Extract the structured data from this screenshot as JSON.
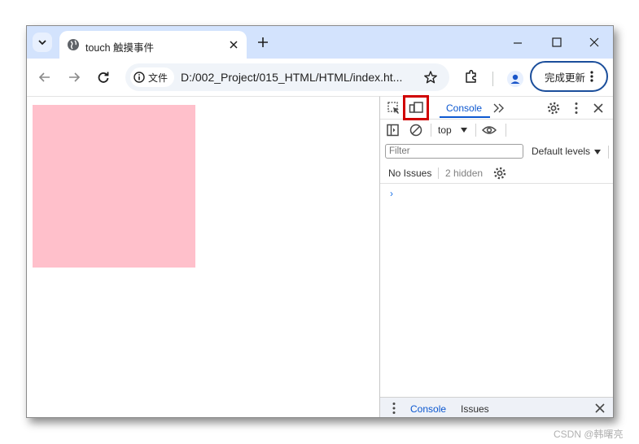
{
  "browser": {
    "tab_title": "touch 触摸事件",
    "url_chip_label": "文件",
    "url": "D:/002_Project/015_HTML/HTML/index.ht...",
    "update_button_label": "完成更新"
  },
  "page": {
    "box_color": "#ffc0cb"
  },
  "devtools": {
    "console_tab": "Console",
    "context": "top",
    "filter_placeholder": "Filter",
    "levels_label": "Default levels",
    "no_issues": "No Issues",
    "hidden_count": "2 hidden",
    "prompt": "›",
    "drawer_console_tab": "Console",
    "drawer_issues_tab": "Issues",
    "highlight_color": "#d00000"
  },
  "watermark": "CSDN @韩曙亮"
}
